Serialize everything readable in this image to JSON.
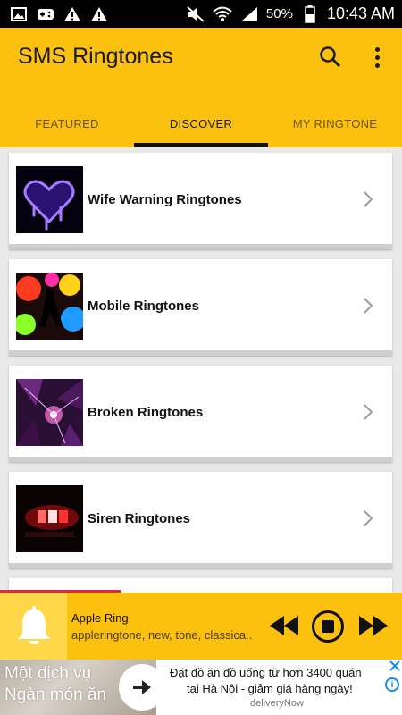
{
  "statusbar": {
    "battery": "50%",
    "time": "10:43 AM",
    "icons": [
      "image-icon",
      "gamepad-icon",
      "warning-icon",
      "warning-icon",
      "mute-icon",
      "wifi-icon",
      "signal-icon",
      "battery-icon"
    ]
  },
  "app": {
    "title": "SMS Ringtones"
  },
  "tabs": [
    "FEATURED",
    "DISCOVER",
    "MY RINGTONE"
  ],
  "active_tab": "DISCOVER",
  "categories": [
    {
      "label": "Wife Warning Ringtones",
      "thumb": "neon-heart"
    },
    {
      "label": "Mobile Ringtones",
      "thumb": "colorful-dancer"
    },
    {
      "label": "Broken Ringtones",
      "thumb": "purple-shards"
    },
    {
      "label": "Siren Ringtones",
      "thumb": "police-lights"
    }
  ],
  "player": {
    "title": "Apple Ring",
    "tags": "appleringtone, new, tone, classica.."
  },
  "ad": {
    "left_line1": "Một dịch vụ",
    "left_line2": "Ngàn món ăn",
    "line1": "Đặt đồ ăn đồ uống từ hơn 3400 quán",
    "line2": "tại Hà Nội - giảm giá hàng ngày!",
    "brand": "deliveryNow"
  },
  "colors": {
    "accent": "#fcc10f",
    "progress": "#e2264d"
  }
}
